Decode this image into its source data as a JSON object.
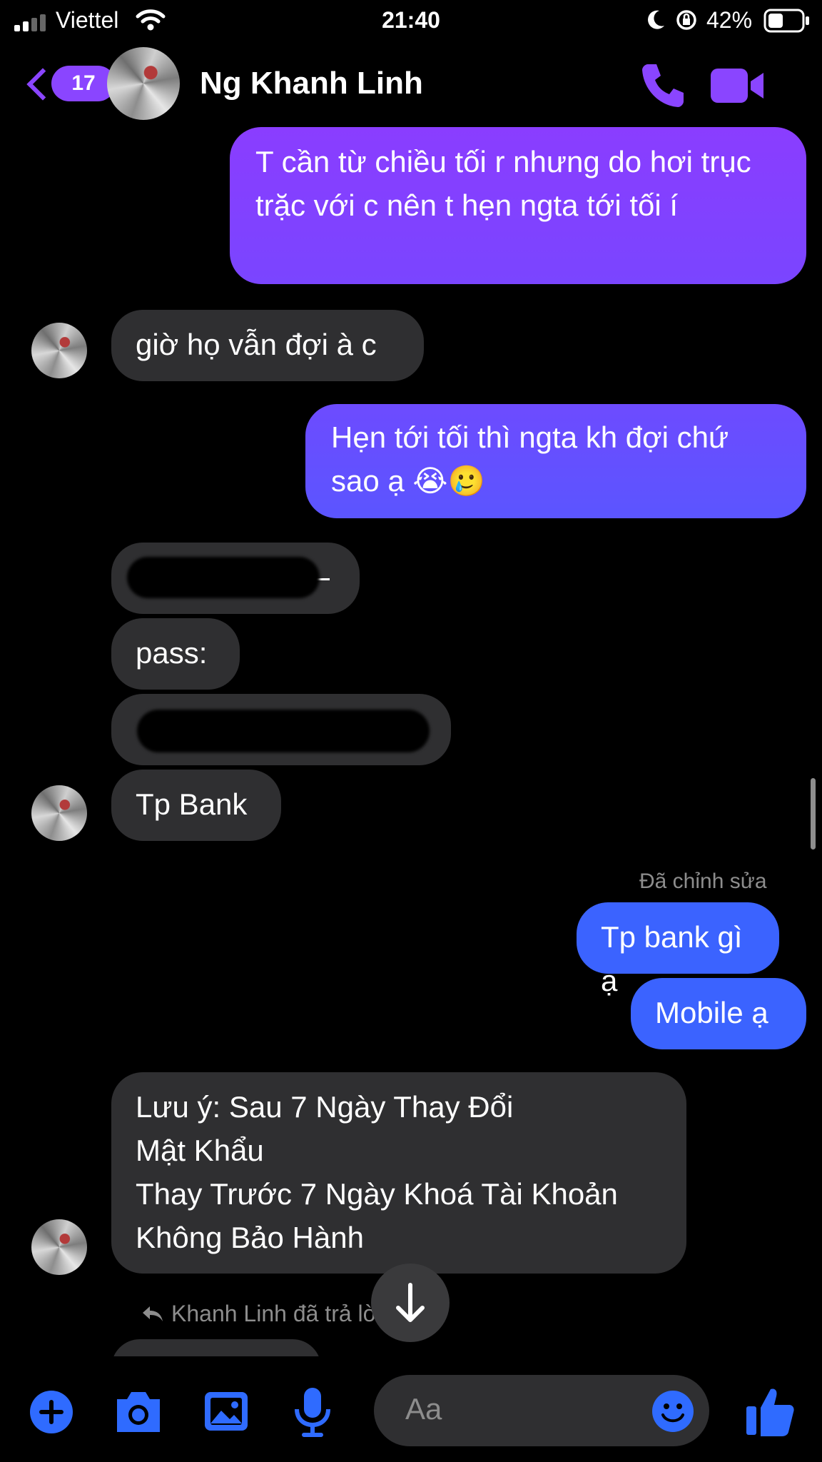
{
  "status_bar": {
    "carrier": "Viettel",
    "time": "21:40",
    "battery": "42%"
  },
  "header": {
    "back_count": "17",
    "contact_name": "Ng Khanh Linh"
  },
  "messages": {
    "m1": "T cần từ chiều tối r nhưng do hơi trục trặc với c nên t hẹn ngta tới tối í",
    "m2": "giờ họ vẫn đợi à c",
    "m3": "Hẹn tới tối thì ngta kh đợi chứ sao ạ 😭🥲",
    "m5": "pass:",
    "m7": "Tp Bank",
    "edited_label": "Đã chỉnh sửa",
    "m8": "Tp bank gì ạ",
    "m9": "Mobile ạ",
    "m10_line1": "Lưu ý: Sau 7 Ngày Thay Đổi",
    "m10_line2": "Mật Khẩu",
    "m10_line3": "Thay Trước 7 Ngày Khoá Tài Khoản",
    "m10_line4": "Không Bảo Hành",
    "reply_note": "Khanh Linh đã trả lời"
  },
  "composer": {
    "placeholder": "Aa"
  },
  "colors": {
    "accent_purple": "#8a45ff",
    "accent_blue": "#3b63ff",
    "incoming_bubble": "#2f2f31"
  }
}
